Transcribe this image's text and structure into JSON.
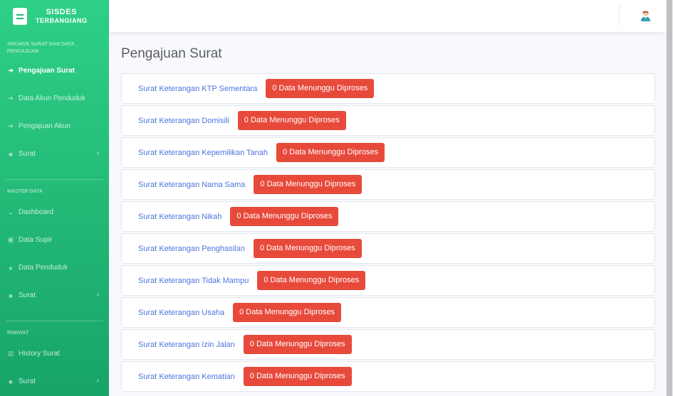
{
  "brand": {
    "line1": "SISDES",
    "line2": "TERBANGIANG"
  },
  "sidebar": {
    "sections": [
      {
        "heading": "ARCHIVE SURAT DAN DATA PENGAJUAN",
        "items": [
          {
            "label": "Pengajuan Surat",
            "icon": "sign-in-icon",
            "active": true
          },
          {
            "label": "Data Akun Penduduk",
            "icon": "sign-in-icon"
          },
          {
            "label": "Pengajuan Akun",
            "icon": "sign-in-icon"
          },
          {
            "label": "Surat",
            "icon": "folder-icon",
            "has_submenu": true
          }
        ]
      },
      {
        "heading": "MASTER DATA",
        "items": [
          {
            "label": "Dashboard",
            "icon": "tachometer-icon"
          },
          {
            "label": "Data Supir",
            "icon": "bus-icon"
          },
          {
            "label": "Data Penduduk",
            "icon": "users-icon"
          },
          {
            "label": "Surat",
            "icon": "folder-icon",
            "has_submenu": true
          }
        ]
      },
      {
        "heading": "RIWAYAT",
        "items": [
          {
            "label": "History Surat",
            "icon": "book-icon"
          },
          {
            "label": "Surat",
            "icon": "folder-icon",
            "has_submenu": true
          }
        ]
      }
    ]
  },
  "topbar": {
    "avatar_icon": "user-avatar-icon"
  },
  "main": {
    "title": "Pengajuan Surat",
    "items": [
      {
        "label": "Surat Keterangan KTP Sementara",
        "badge": "0 Data Menunggu Diproses"
      },
      {
        "label": "Surat Keterangan Domisili",
        "badge": "0 Data Menunggu Diproses"
      },
      {
        "label": "Surat Keterangan Kepemilikan Tanah",
        "badge": "0 Data Menunggu Diproses"
      },
      {
        "label": "Surat Keterangan Nama Sama",
        "badge": "0 Data Menunggu Diproses"
      },
      {
        "label": "Surat Keterangan Nikah",
        "badge": "0 Data Menunggu Diproses"
      },
      {
        "label": "Surat Keterangan Penghasilan",
        "badge": "0 Data Menunggu Diproses"
      },
      {
        "label": "Surat Keterangan Tidak Mampu",
        "badge": "0 Data Menunggu Diproses"
      },
      {
        "label": "Surat Keterangan Usaha",
        "badge": "0 Data Menunggu Diproses"
      },
      {
        "label": "Surat Keterangan Izin Jalan",
        "badge": "0 Data Menunggu Diproses"
      },
      {
        "label": "Surat Keterangan Kematian",
        "badge": "0 Data Menunggu Diproses"
      }
    ]
  },
  "colors": {
    "sidebar_top": "#2fd087",
    "sidebar_bottom": "#17a468",
    "link": "#4e73df",
    "badge": "#e74a3b"
  }
}
